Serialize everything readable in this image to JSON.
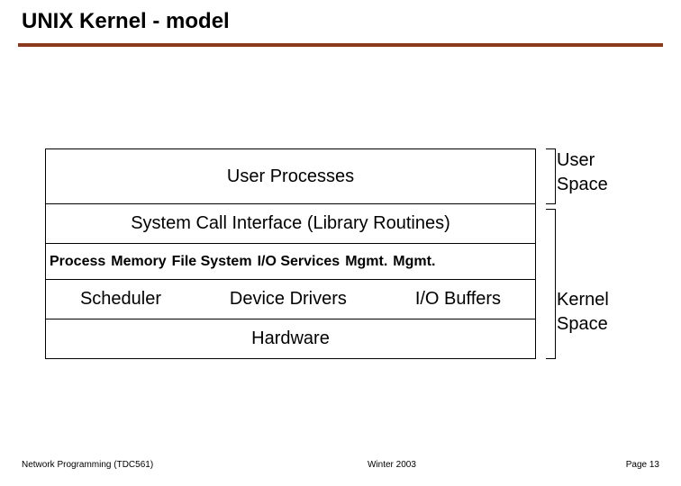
{
  "title": "UNIX Kernel - model",
  "rows": {
    "user_processes": "User Processes",
    "syscall": "System Call  Interface (Library Routines)",
    "mgmt": {
      "process": "Process",
      "memory": "Memory",
      "filesystem": "File System",
      "io": "I/O Services",
      "mgmt1": "Mgmt.",
      "mgmt2": "Mgmt."
    },
    "scheduler": "Scheduler",
    "device_drivers": "Device Drivers",
    "io_buffers": "I/O  Buffers",
    "hardware": "Hardware"
  },
  "labels": {
    "user_line1": "User",
    "user_line2": "Space",
    "kernel_line1": "Kernel",
    "kernel_line2": "Space"
  },
  "footer": {
    "left": "Network Programming (TDC561)",
    "mid": "Winter  2003",
    "right": "Page 13"
  },
  "accent_color": "#8b3a1e"
}
